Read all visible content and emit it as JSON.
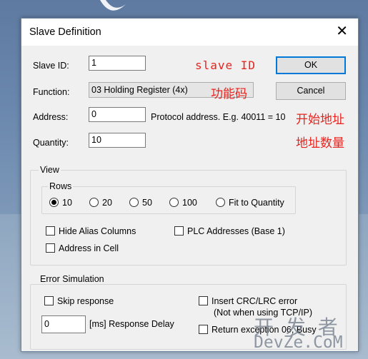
{
  "dialog": {
    "title": "Slave Definition",
    "close_glyph": "✕",
    "ok_label": "OK",
    "cancel_label": "Cancel"
  },
  "fields": {
    "slave_id_label": "Slave ID:",
    "slave_id_value": "1",
    "function_label": "Function:",
    "function_value": "03 Holding Register (4x)",
    "address_label": "Address:",
    "address_value": "0",
    "address_hint": "Protocol address. E.g. 40011 = 10",
    "quantity_label": "Quantity:",
    "quantity_value": "10"
  },
  "annotations": {
    "slave_id": "slave ID",
    "function": "功能码",
    "address": "开始地址",
    "quantity": "地址数量",
    "color": "#e8231d"
  },
  "view": {
    "title": "View",
    "rows_title": "Rows",
    "rows_options": [
      "10",
      "20",
      "50",
      "100",
      "Fit to Quantity"
    ],
    "rows_selected": "10",
    "hide_alias_label": "Hide Alias Columns",
    "plc_addresses_label": "PLC Addresses (Base 1)",
    "address_in_cell_label": "Address in Cell"
  },
  "error_simulation": {
    "title": "Error Simulation",
    "skip_response_label": "Skip response",
    "delay_value": "0",
    "delay_label": "[ms] Response Delay",
    "insert_crc_label": "Insert CRC/LRC error",
    "insert_crc_note": "(Not when using TCP/IP)",
    "return_exception_label": "Return exception 06, Busy"
  },
  "watermark": {
    "line1": "开 发 者",
    "line2": "DevZe.CoM"
  },
  "colors": {
    "accent": "#0078d7",
    "annotation": "#e8231d",
    "dialog_bg": "#f0f0f0"
  }
}
